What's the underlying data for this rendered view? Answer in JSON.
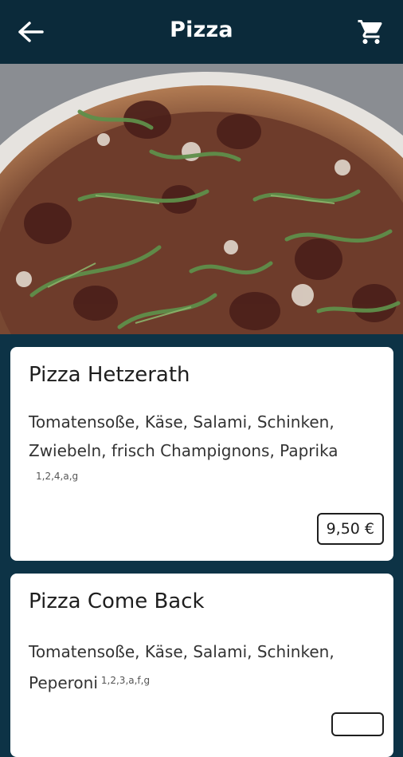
{
  "header": {
    "title": "Pizza",
    "back_icon": "arrow-left-icon",
    "cart_icon": "shopping-cart-icon"
  },
  "hero_image": {
    "description_icon": "pizza-photo"
  },
  "products": [
    {
      "name": "Pizza Hetzerath",
      "description": "Tomatensoße, Käse, Salami, Schinken, Zwiebeln, frisch Champignons, Paprika",
      "allergens": "1,2,4,a,g",
      "price": "9,50 €"
    },
    {
      "name": "Pizza Come Back",
      "description": "Tomatensoße, Käse, Salami, Schinken, Peperoni",
      "allergens": "1,2,3,a,f,g"
    }
  ],
  "colors": {
    "header_bg": "#0b2a3a",
    "page_bg": "#0d3346",
    "card_bg": "#ffffff"
  }
}
